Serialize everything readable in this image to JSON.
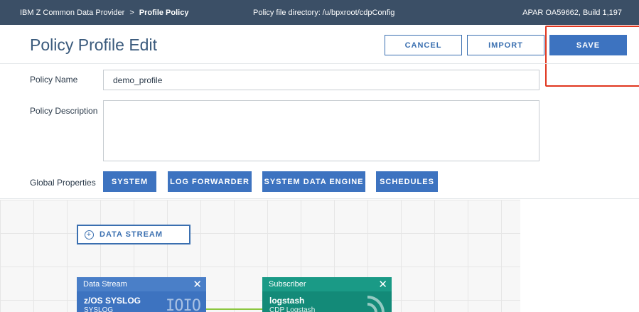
{
  "topbar": {
    "product": "IBM Z Common Data Provider",
    "separator": ">",
    "page": "Profile Policy",
    "directory": "Policy file directory: /u/bpxroot/cdpConfig",
    "build": "APAR OA59662, Build 1,197"
  },
  "header": {
    "title": "Policy Profile Edit",
    "cancel_label": "CANCEL",
    "import_label": "IMPORT",
    "save_label": "SAVE"
  },
  "form": {
    "name_label": "Policy Name",
    "name_value": "demo_profile",
    "description_label": "Policy Description",
    "description_value": "",
    "global_label": "Global Properties",
    "global_buttons": [
      "SYSTEM",
      "LOG FORWARDER",
      "SYSTEM DATA ENGINE",
      "SCHEDULES"
    ]
  },
  "canvas": {
    "add_stream_label": "DATA STREAM",
    "data_stream_node": {
      "header": "Data Stream",
      "name": "z/OS SYSLOG",
      "subtitle": "SYSLOG",
      "icon": "binary-icon",
      "glyph": "IOIO"
    },
    "subscriber_node": {
      "header": "Subscriber",
      "name": "logstash",
      "subtitle": "CDP Logstash",
      "icon": "feed-icon"
    }
  },
  "colors": {
    "topbar": "#3b4f66",
    "primary": "#3d73c0",
    "subscriber": "#138a78",
    "highlight": "#e0361f",
    "connector": "#8cc63f"
  }
}
